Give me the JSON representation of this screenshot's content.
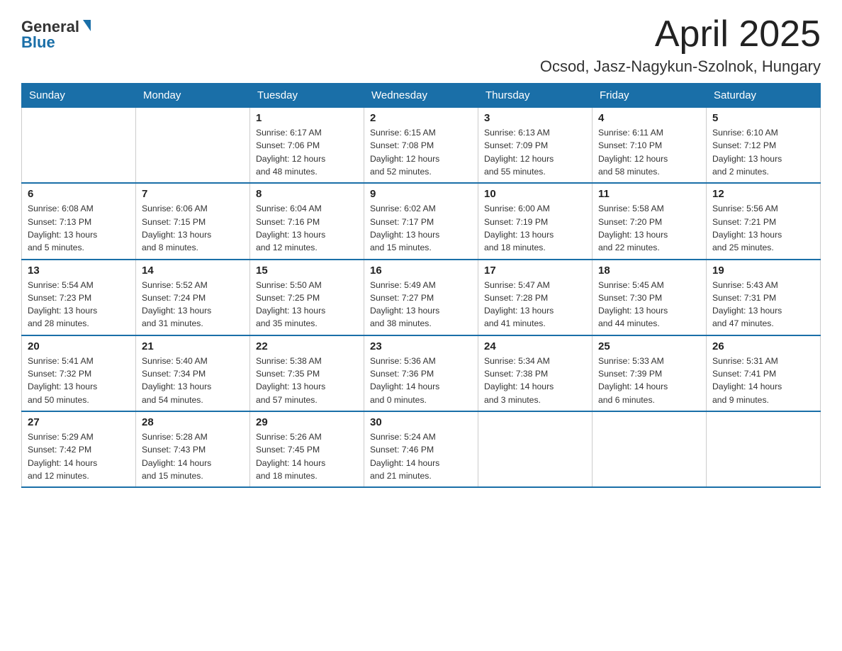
{
  "header": {
    "logo_general": "General",
    "logo_blue": "Blue",
    "month_title": "April 2025",
    "location": "Ocsod, Jasz-Nagykun-Szolnok, Hungary"
  },
  "days_of_week": [
    "Sunday",
    "Monday",
    "Tuesday",
    "Wednesday",
    "Thursday",
    "Friday",
    "Saturday"
  ],
  "weeks": [
    [
      {
        "day": "",
        "info": ""
      },
      {
        "day": "",
        "info": ""
      },
      {
        "day": "1",
        "info": "Sunrise: 6:17 AM\nSunset: 7:06 PM\nDaylight: 12 hours\nand 48 minutes."
      },
      {
        "day": "2",
        "info": "Sunrise: 6:15 AM\nSunset: 7:08 PM\nDaylight: 12 hours\nand 52 minutes."
      },
      {
        "day": "3",
        "info": "Sunrise: 6:13 AM\nSunset: 7:09 PM\nDaylight: 12 hours\nand 55 minutes."
      },
      {
        "day": "4",
        "info": "Sunrise: 6:11 AM\nSunset: 7:10 PM\nDaylight: 12 hours\nand 58 minutes."
      },
      {
        "day": "5",
        "info": "Sunrise: 6:10 AM\nSunset: 7:12 PM\nDaylight: 13 hours\nand 2 minutes."
      }
    ],
    [
      {
        "day": "6",
        "info": "Sunrise: 6:08 AM\nSunset: 7:13 PM\nDaylight: 13 hours\nand 5 minutes."
      },
      {
        "day": "7",
        "info": "Sunrise: 6:06 AM\nSunset: 7:15 PM\nDaylight: 13 hours\nand 8 minutes."
      },
      {
        "day": "8",
        "info": "Sunrise: 6:04 AM\nSunset: 7:16 PM\nDaylight: 13 hours\nand 12 minutes."
      },
      {
        "day": "9",
        "info": "Sunrise: 6:02 AM\nSunset: 7:17 PM\nDaylight: 13 hours\nand 15 minutes."
      },
      {
        "day": "10",
        "info": "Sunrise: 6:00 AM\nSunset: 7:19 PM\nDaylight: 13 hours\nand 18 minutes."
      },
      {
        "day": "11",
        "info": "Sunrise: 5:58 AM\nSunset: 7:20 PM\nDaylight: 13 hours\nand 22 minutes."
      },
      {
        "day": "12",
        "info": "Sunrise: 5:56 AM\nSunset: 7:21 PM\nDaylight: 13 hours\nand 25 minutes."
      }
    ],
    [
      {
        "day": "13",
        "info": "Sunrise: 5:54 AM\nSunset: 7:23 PM\nDaylight: 13 hours\nand 28 minutes."
      },
      {
        "day": "14",
        "info": "Sunrise: 5:52 AM\nSunset: 7:24 PM\nDaylight: 13 hours\nand 31 minutes."
      },
      {
        "day": "15",
        "info": "Sunrise: 5:50 AM\nSunset: 7:25 PM\nDaylight: 13 hours\nand 35 minutes."
      },
      {
        "day": "16",
        "info": "Sunrise: 5:49 AM\nSunset: 7:27 PM\nDaylight: 13 hours\nand 38 minutes."
      },
      {
        "day": "17",
        "info": "Sunrise: 5:47 AM\nSunset: 7:28 PM\nDaylight: 13 hours\nand 41 minutes."
      },
      {
        "day": "18",
        "info": "Sunrise: 5:45 AM\nSunset: 7:30 PM\nDaylight: 13 hours\nand 44 minutes."
      },
      {
        "day": "19",
        "info": "Sunrise: 5:43 AM\nSunset: 7:31 PM\nDaylight: 13 hours\nand 47 minutes."
      }
    ],
    [
      {
        "day": "20",
        "info": "Sunrise: 5:41 AM\nSunset: 7:32 PM\nDaylight: 13 hours\nand 50 minutes."
      },
      {
        "day": "21",
        "info": "Sunrise: 5:40 AM\nSunset: 7:34 PM\nDaylight: 13 hours\nand 54 minutes."
      },
      {
        "day": "22",
        "info": "Sunrise: 5:38 AM\nSunset: 7:35 PM\nDaylight: 13 hours\nand 57 minutes."
      },
      {
        "day": "23",
        "info": "Sunrise: 5:36 AM\nSunset: 7:36 PM\nDaylight: 14 hours\nand 0 minutes."
      },
      {
        "day": "24",
        "info": "Sunrise: 5:34 AM\nSunset: 7:38 PM\nDaylight: 14 hours\nand 3 minutes."
      },
      {
        "day": "25",
        "info": "Sunrise: 5:33 AM\nSunset: 7:39 PM\nDaylight: 14 hours\nand 6 minutes."
      },
      {
        "day": "26",
        "info": "Sunrise: 5:31 AM\nSunset: 7:41 PM\nDaylight: 14 hours\nand 9 minutes."
      }
    ],
    [
      {
        "day": "27",
        "info": "Sunrise: 5:29 AM\nSunset: 7:42 PM\nDaylight: 14 hours\nand 12 minutes."
      },
      {
        "day": "28",
        "info": "Sunrise: 5:28 AM\nSunset: 7:43 PM\nDaylight: 14 hours\nand 15 minutes."
      },
      {
        "day": "29",
        "info": "Sunrise: 5:26 AM\nSunset: 7:45 PM\nDaylight: 14 hours\nand 18 minutes."
      },
      {
        "day": "30",
        "info": "Sunrise: 5:24 AM\nSunset: 7:46 PM\nDaylight: 14 hours\nand 21 minutes."
      },
      {
        "day": "",
        "info": ""
      },
      {
        "day": "",
        "info": ""
      },
      {
        "day": "",
        "info": ""
      }
    ]
  ]
}
